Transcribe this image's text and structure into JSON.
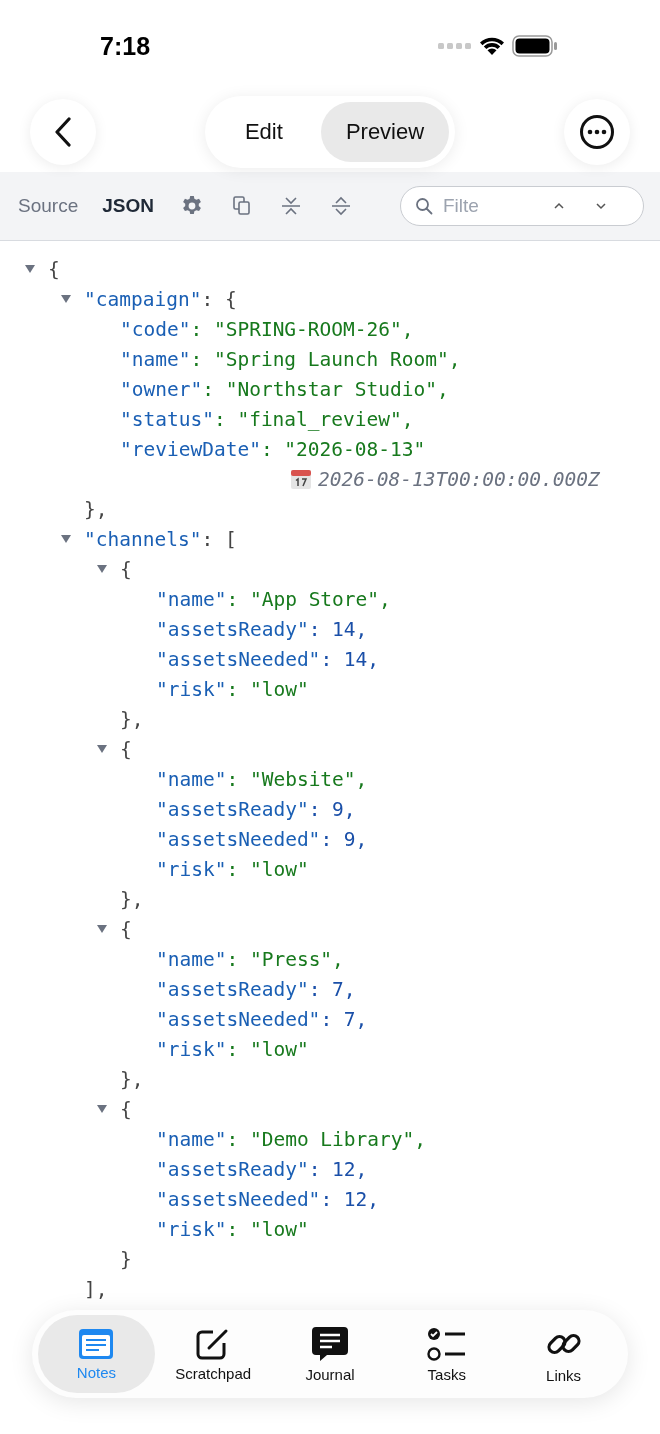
{
  "status_bar": {
    "time": "7:18"
  },
  "header": {
    "segments": [
      {
        "label": "Edit",
        "selected": false
      },
      {
        "label": "Preview",
        "selected": true
      }
    ]
  },
  "toolbar": {
    "modes": [
      {
        "label": "Source",
        "selected": false
      },
      {
        "label": "JSON",
        "selected": true
      }
    ],
    "filter": {
      "placeholder": "Filte"
    }
  },
  "tree": {
    "open": "{",
    "expanded": true,
    "children": [
      {
        "key": "\"campaign\"",
        "open": ": {",
        "expanded": true,
        "close": "},",
        "children": [
          {
            "key": "\"code\"",
            "value": ": \"SPRING-ROOM-26\",",
            "kind": "string"
          },
          {
            "key": "\"name\"",
            "value": ": \"Spring Launch Room\",",
            "kind": "string"
          },
          {
            "key": "\"owner\"",
            "value": ": \"Northstar Studio\",",
            "kind": "string"
          },
          {
            "key": "\"status\"",
            "value": ": \"final_review\",",
            "kind": "string"
          },
          {
            "key": "\"reviewDate\"",
            "value": ": \"2026-08-13\"",
            "kind": "string",
            "annotation": "2026-08-13T00:00:00.000Z"
          }
        ]
      },
      {
        "key": "\"channels\"",
        "open": ": [",
        "expanded": true,
        "close": "],",
        "children": [
          {
            "open": "{",
            "expanded": true,
            "close": "},",
            "children": [
              {
                "key": "\"name\"",
                "value": ": \"App Store\",",
                "kind": "string"
              },
              {
                "key": "\"assetsReady\"",
                "value": ": 14,",
                "kind": "number"
              },
              {
                "key": "\"assetsNeeded\"",
                "value": ": 14,",
                "kind": "number"
              },
              {
                "key": "\"risk\"",
                "value": ": \"low\"",
                "kind": "string"
              }
            ]
          },
          {
            "open": "{",
            "expanded": true,
            "close": "},",
            "children": [
              {
                "key": "\"name\"",
                "value": ": \"Website\",",
                "kind": "string"
              },
              {
                "key": "\"assetsReady\"",
                "value": ": 9,",
                "kind": "number"
              },
              {
                "key": "\"assetsNeeded\"",
                "value": ": 9,",
                "kind": "number"
              },
              {
                "key": "\"risk\"",
                "value": ": \"low\"",
                "kind": "string"
              }
            ]
          },
          {
            "open": "{",
            "expanded": true,
            "close": "},",
            "children": [
              {
                "key": "\"name\"",
                "value": ": \"Press\",",
                "kind": "string"
              },
              {
                "key": "\"assetsReady\"",
                "value": ": 7,",
                "kind": "number"
              },
              {
                "key": "\"assetsNeeded\"",
                "value": ": 7,",
                "kind": "number"
              },
              {
                "key": "\"risk\"",
                "value": ": \"low\"",
                "kind": "string"
              }
            ]
          },
          {
            "open": "{",
            "expanded": true,
            "close": "}",
            "children": [
              {
                "key": "\"name\"",
                "value": ": \"Demo Library\",",
                "kind": "string"
              },
              {
                "key": "\"assetsReady\"",
                "value": ": 12,",
                "kind": "number"
              },
              {
                "key": "\"assetsNeeded\"",
                "value": ": 12,",
                "kind": "number"
              },
              {
                "key": "\"risk\"",
                "value": ": \"low\"",
                "kind": "string"
              }
            ]
          }
        ]
      }
    ]
  },
  "tab_bar": [
    {
      "label": "Notes",
      "kind": "notes",
      "selected": true
    },
    {
      "label": "Scratchpad",
      "kind": "compose",
      "selected": false
    },
    {
      "label": "Journal",
      "kind": "chat",
      "selected": false
    },
    {
      "label": "Tasks",
      "kind": "checklist",
      "selected": false
    },
    {
      "label": "Links",
      "kind": "link",
      "selected": false
    }
  ]
}
